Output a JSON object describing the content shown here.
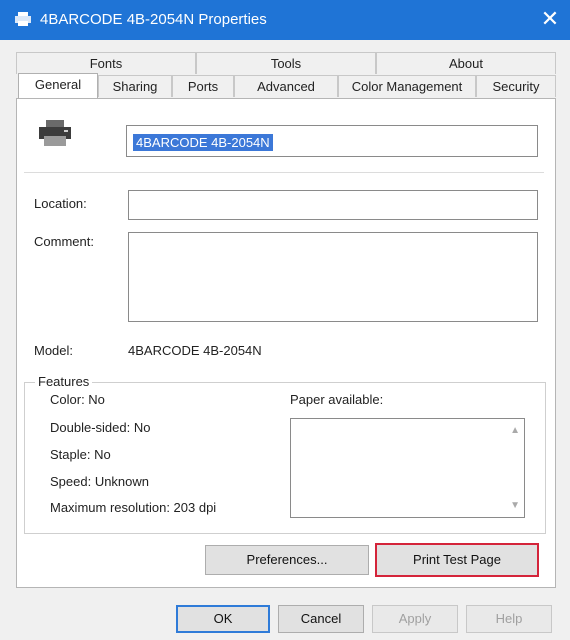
{
  "window": {
    "title": "4BARCODE 4B-2054N Properties",
    "close": "✕"
  },
  "tabs_row1": [
    "Fonts",
    "Tools",
    "About"
  ],
  "tabs_row2": [
    "General",
    "Sharing",
    "Ports",
    "Advanced",
    "Color Management",
    "Security"
  ],
  "printer_name": "4BARCODE 4B-2054N",
  "labels": {
    "location": "Location:",
    "comment": "Comment:",
    "model": "Model:"
  },
  "model_value": "4BARCODE 4B-2054N",
  "features": {
    "legend": "Features",
    "color": "Color: No",
    "double_sided": "Double-sided: No",
    "staple": "Staple: No",
    "speed": "Speed: Unknown",
    "max_res": "Maximum resolution: 203 dpi",
    "paper_label": "Paper available:"
  },
  "buttons": {
    "preferences": "Preferences...",
    "print_test": "Print Test Page",
    "ok": "OK",
    "cancel": "Cancel",
    "apply": "Apply",
    "help": "Help"
  }
}
